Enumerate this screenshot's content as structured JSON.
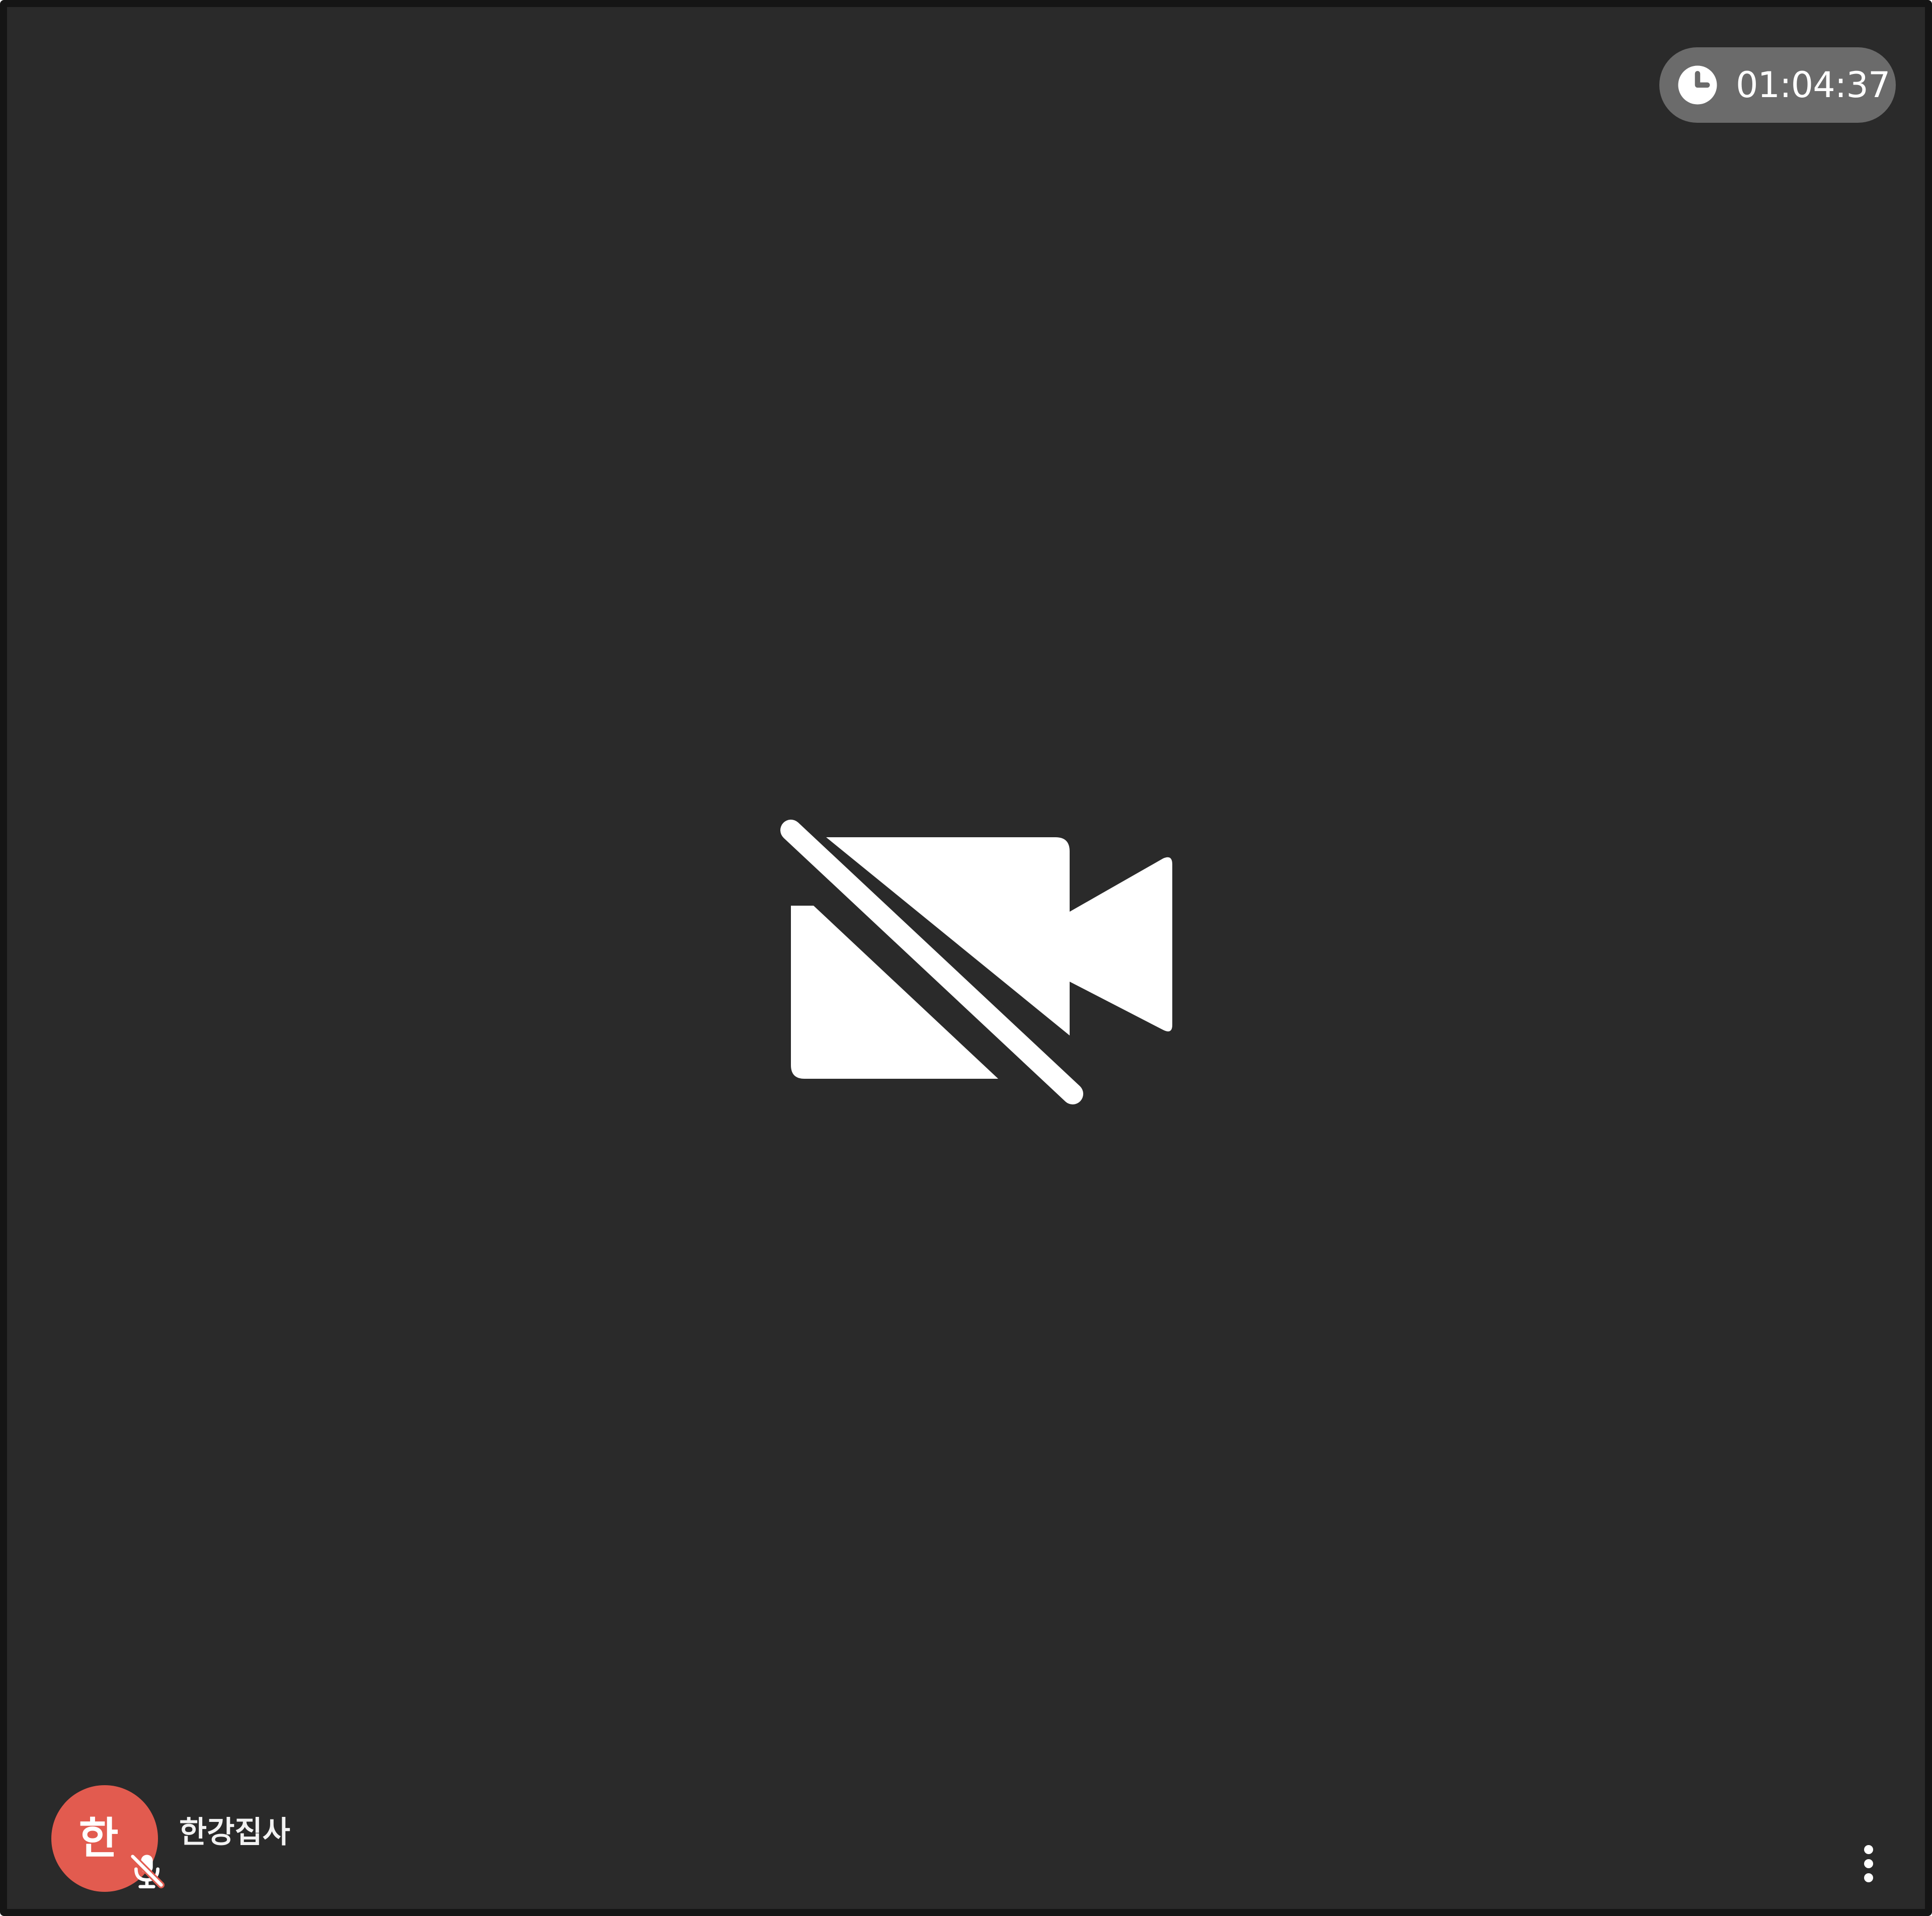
{
  "call": {
    "elapsed_time": "01:04:37"
  },
  "video": {
    "status_icon": "video-off-icon"
  },
  "participant": {
    "initial": "한",
    "name": "한강집사",
    "mic_icon": "mic-off-icon",
    "avatar_color": "#e25b4f"
  },
  "controls": {
    "more_icon": "more-vertical-icon"
  },
  "colors": {
    "tile_background": "#2a2a2a",
    "timer_background": "#6b6b6b",
    "border": "#151515"
  }
}
